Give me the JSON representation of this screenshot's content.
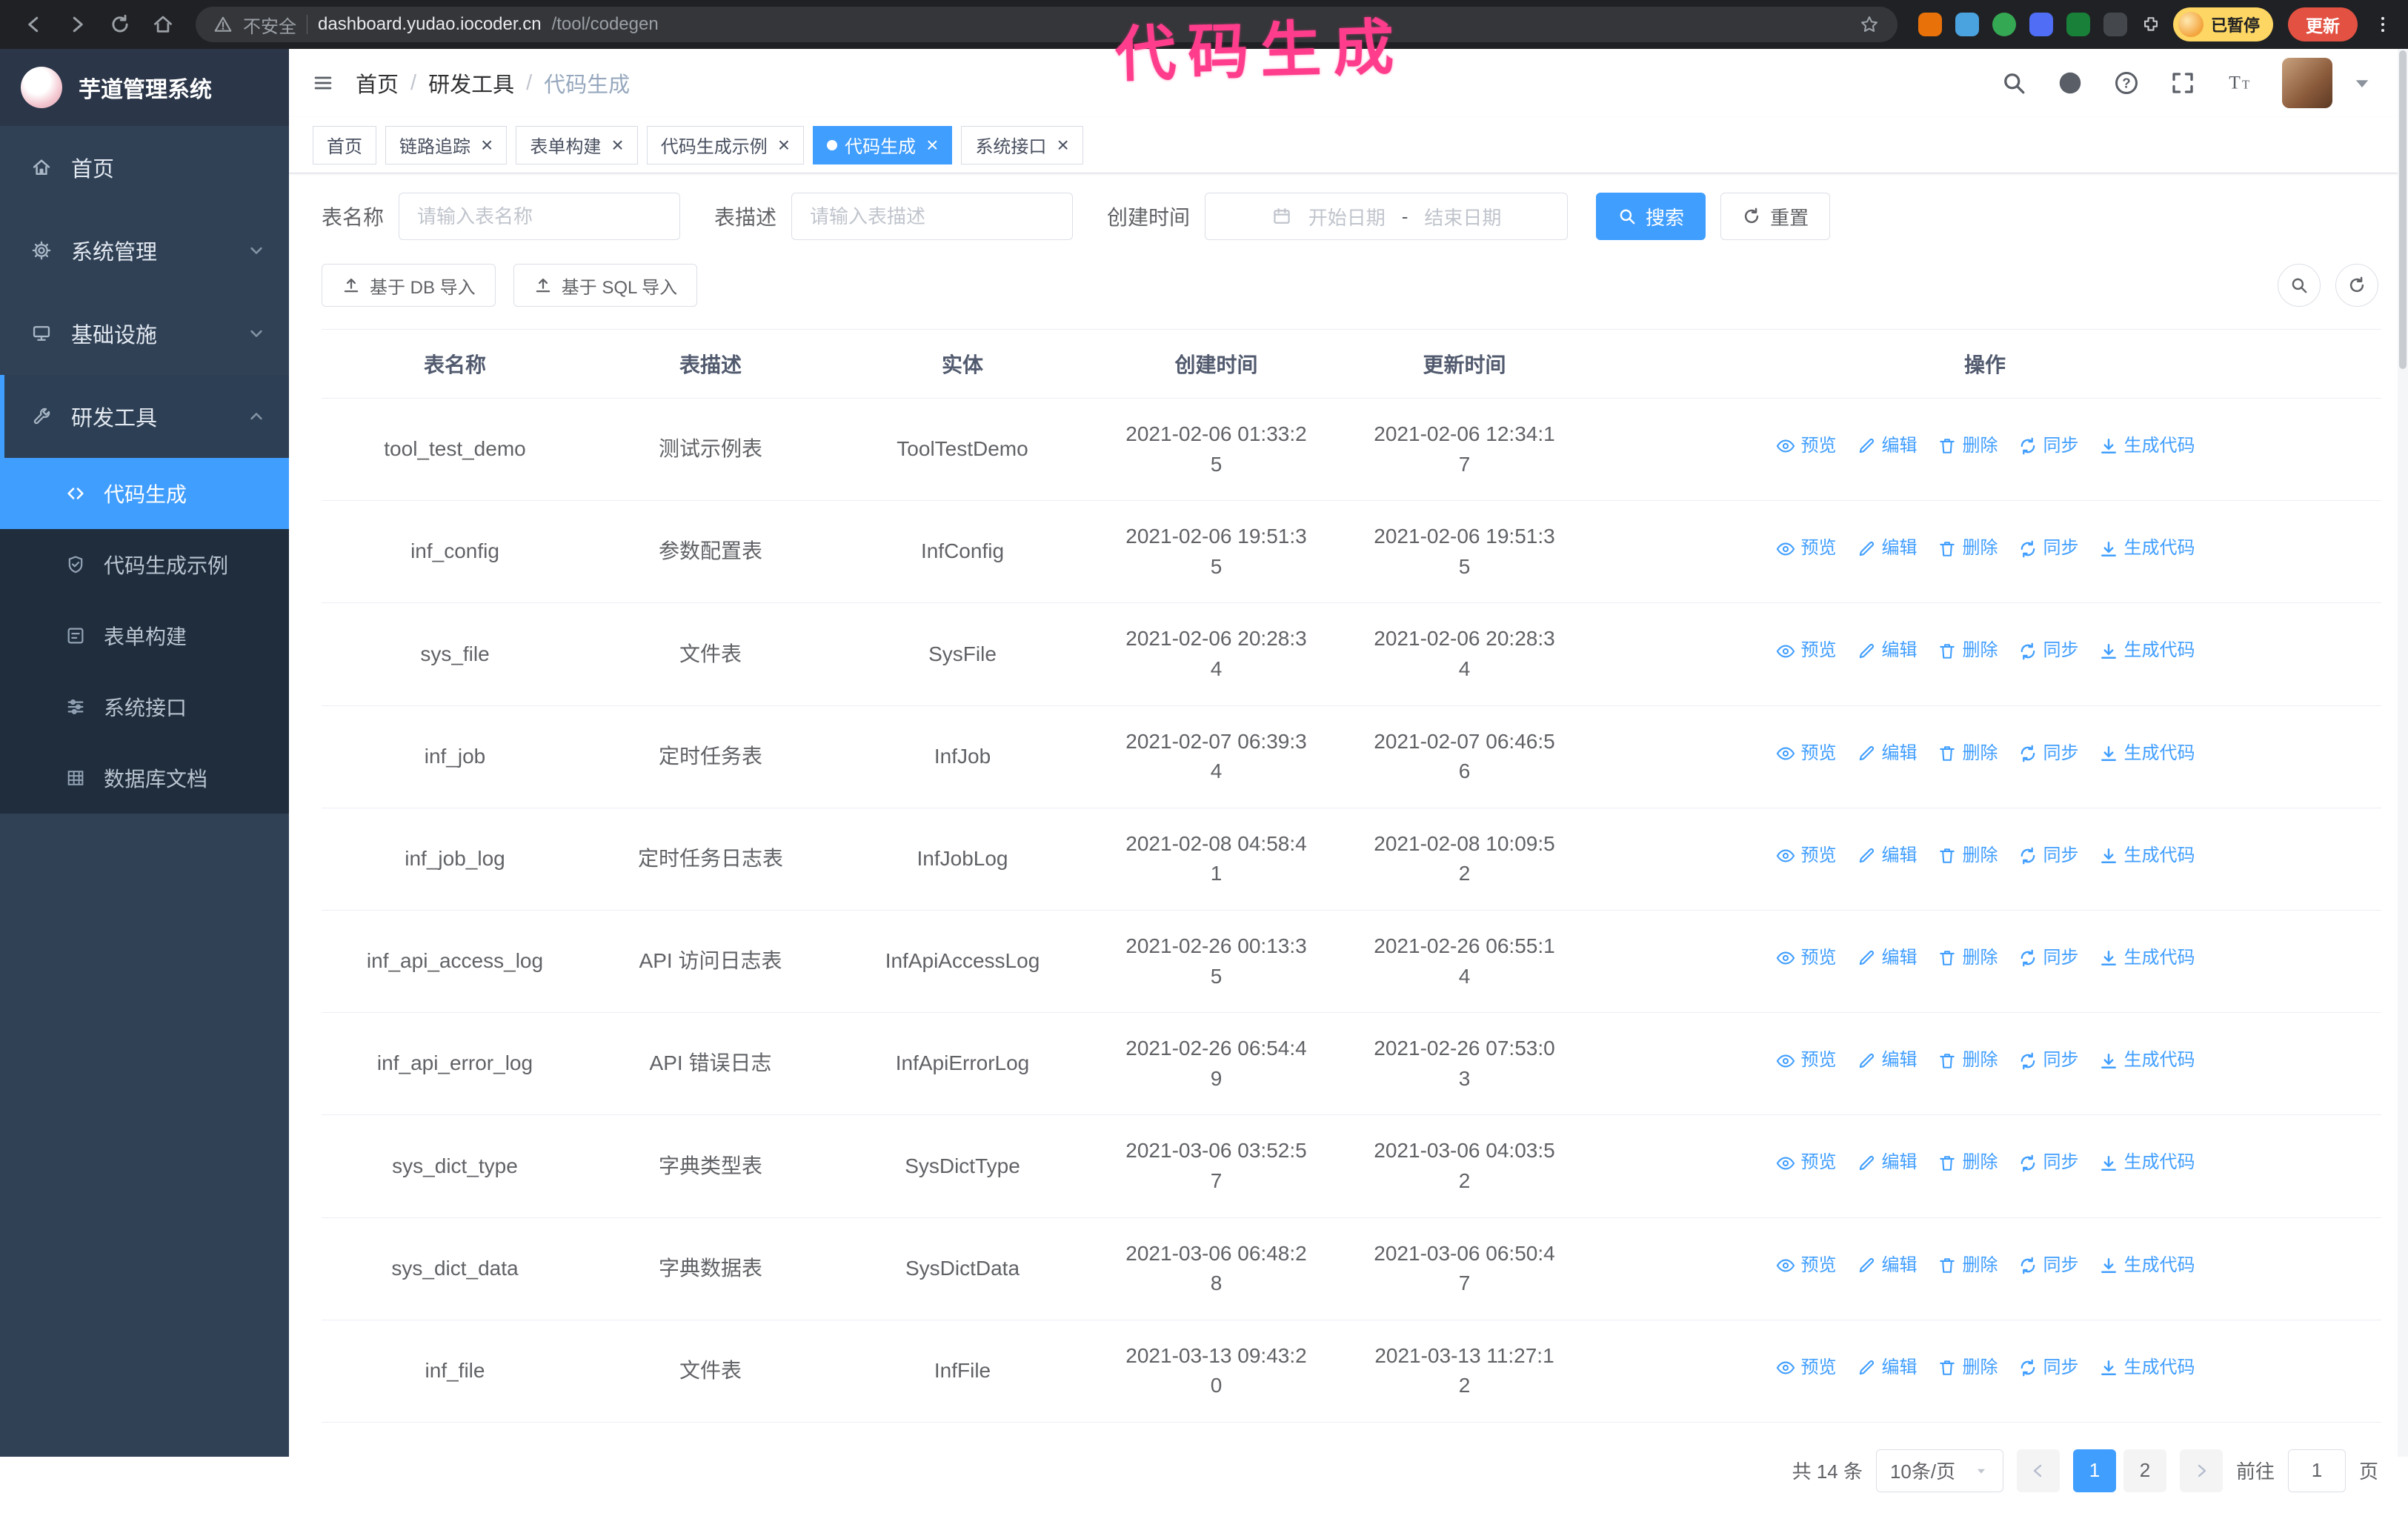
{
  "browser": {
    "security_label": "不安全",
    "url_host": "dashboard.yudao.iocoder.cn",
    "url_path": "/tool/codegen",
    "paused_badge": "已暂停",
    "update_button": "更新"
  },
  "annotation": "代码生成",
  "colors": {
    "accent": "#409eff",
    "sidebar_bg": "#304156",
    "submenu_bg": "#1f2d3d",
    "annotation_pink": "#ff3d8c"
  },
  "sidebar": {
    "logo_title": "芋道管理系统",
    "items": [
      {
        "key": "home",
        "label": "首页",
        "icon": "i-home2",
        "chevron": null,
        "expanded": false
      },
      {
        "key": "system",
        "label": "系统管理",
        "icon": "i-gear",
        "chevron": "down",
        "expanded": false
      },
      {
        "key": "infra",
        "label": "基础设施",
        "icon": "i-infra",
        "chevron": "down",
        "expanded": false
      },
      {
        "key": "devtools",
        "label": "研发工具",
        "icon": "i-tool",
        "chevron": "up",
        "expanded": true
      }
    ],
    "subitems": [
      {
        "key": "codegen",
        "label": "代码生成",
        "icon": "i-code",
        "active": true
      },
      {
        "key": "codegen-example",
        "label": "代码生成示例",
        "icon": "i-shield",
        "active": false
      },
      {
        "key": "form-builder",
        "label": "表单构建",
        "icon": "i-form",
        "active": false
      },
      {
        "key": "system-api",
        "label": "系统接口",
        "icon": "i-sliders",
        "active": false
      },
      {
        "key": "db-doc",
        "label": "数据库文档",
        "icon": "i-grid",
        "active": false
      }
    ]
  },
  "header": {
    "breadcrumb": [
      "首页",
      "研发工具",
      "代码生成"
    ]
  },
  "tabs": [
    {
      "key": "home",
      "label": "首页",
      "closable": false,
      "active": false
    },
    {
      "key": "trace",
      "label": "链路追踪",
      "closable": true,
      "active": false
    },
    {
      "key": "form-builder",
      "label": "表单构建",
      "closable": true,
      "active": false
    },
    {
      "key": "codegen-example",
      "label": "代码生成示例",
      "closable": true,
      "active": false
    },
    {
      "key": "codegen",
      "label": "代码生成",
      "closable": true,
      "active": true
    },
    {
      "key": "system-api",
      "label": "系统接口",
      "closable": true,
      "active": false
    }
  ],
  "filters": {
    "table_name_label": "表名称",
    "table_name_placeholder": "请输入表名称",
    "table_desc_label": "表描述",
    "table_desc_placeholder": "请输入表描述",
    "create_time_label": "创建时间",
    "date_start_placeholder": "开始日期",
    "date_separator": "-",
    "date_end_placeholder": "结束日期",
    "search_label": "搜索",
    "reset_label": "重置"
  },
  "toolbar": {
    "import_db_label": "基于 DB 导入",
    "import_sql_label": "基于 SQL 导入"
  },
  "table": {
    "columns": [
      "表名称",
      "表描述",
      "实体",
      "创建时间",
      "更新时间",
      "操作"
    ],
    "actions": [
      {
        "name": "preview",
        "label": "预览",
        "icon": "i-eye"
      },
      {
        "name": "edit",
        "label": "编辑",
        "icon": "i-edit"
      },
      {
        "name": "delete",
        "label": "删除",
        "icon": "i-del"
      },
      {
        "name": "sync",
        "label": "同步",
        "icon": "i-sync"
      },
      {
        "name": "generate-code",
        "label": "生成代码",
        "icon": "i-dl"
      }
    ],
    "rows": [
      {
        "name": "tool_test_demo",
        "desc": "测试示例表",
        "entity": "ToolTestDemo",
        "created": "2021-02-06 01:33:25",
        "updated": "2021-02-06 12:34:17"
      },
      {
        "name": "inf_config",
        "desc": "参数配置表",
        "entity": "InfConfig",
        "created": "2021-02-06 19:51:35",
        "updated": "2021-02-06 19:51:35"
      },
      {
        "name": "sys_file",
        "desc": "文件表",
        "entity": "SysFile",
        "created": "2021-02-06 20:28:34",
        "updated": "2021-02-06 20:28:34"
      },
      {
        "name": "inf_job",
        "desc": "定时任务表",
        "entity": "InfJob",
        "created": "2021-02-07 06:39:34",
        "updated": "2021-02-07 06:46:56"
      },
      {
        "name": "inf_job_log",
        "desc": "定时任务日志表",
        "entity": "InfJobLog",
        "created": "2021-02-08 04:58:41",
        "updated": "2021-02-08 10:09:52"
      },
      {
        "name": "inf_api_access_log",
        "desc": "API 访问日志表",
        "entity": "InfApiAccessLog",
        "created": "2021-02-26 00:13:35",
        "updated": "2021-02-26 06:55:14"
      },
      {
        "name": "inf_api_error_log",
        "desc": "API 错误日志",
        "entity": "InfApiErrorLog",
        "created": "2021-02-26 06:54:49",
        "updated": "2021-02-26 07:53:03"
      },
      {
        "name": "sys_dict_type",
        "desc": "字典类型表",
        "entity": "SysDictType",
        "created": "2021-03-06 03:52:57",
        "updated": "2021-03-06 04:03:52"
      },
      {
        "name": "sys_dict_data",
        "desc": "字典数据表",
        "entity": "SysDictData",
        "created": "2021-03-06 06:48:28",
        "updated": "2021-03-06 06:50:47"
      },
      {
        "name": "inf_file",
        "desc": "文件表",
        "entity": "InfFile",
        "created": "2021-03-13 09:43:20",
        "updated": "2021-03-13 11:27:12"
      }
    ]
  },
  "pagination": {
    "total_label": "共 14 条",
    "page_size_label": "10条/页",
    "pages": [
      "1",
      "2"
    ],
    "active_page": "1",
    "goto_label": "前往",
    "goto_value": "1",
    "unit_label": "页"
  }
}
